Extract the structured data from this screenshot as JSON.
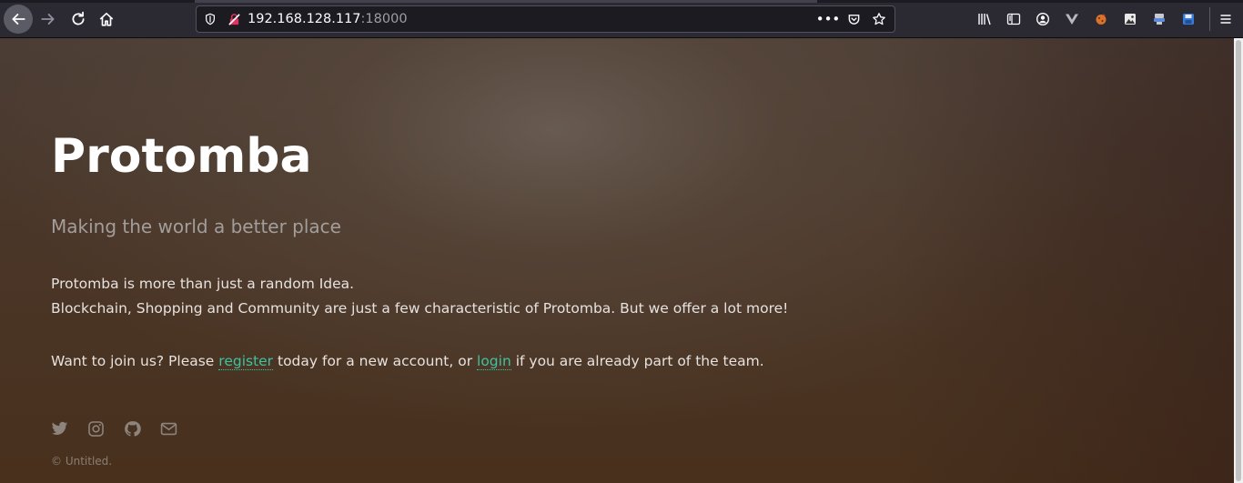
{
  "browser": {
    "url_host": "192.168.128.117",
    "url_port": ":18000",
    "overflow_menu_glyph": "•••"
  },
  "page": {
    "title": "Protomba",
    "subtitle": "Making the world a better place",
    "paragraph_1": "Protomba is more than just a random Idea.",
    "paragraph_2": "Blockchain, Shopping and Community are just a few characteristic of Protomba. But we offer a lot more!",
    "join_prefix": "Want to join us? Please ",
    "register_link": "register",
    "join_middle": " today for a new account, or ",
    "login_link": "login",
    "join_suffix": " if you are already part of the team.",
    "copyright": "© Untitled."
  },
  "colors": {
    "link": "#3ec2a0",
    "toolbar": "#2b2a33",
    "title": "#ffffff"
  },
  "icons": {
    "social": [
      "twitter-icon",
      "instagram-icon",
      "github-icon",
      "envelope-icon"
    ]
  }
}
